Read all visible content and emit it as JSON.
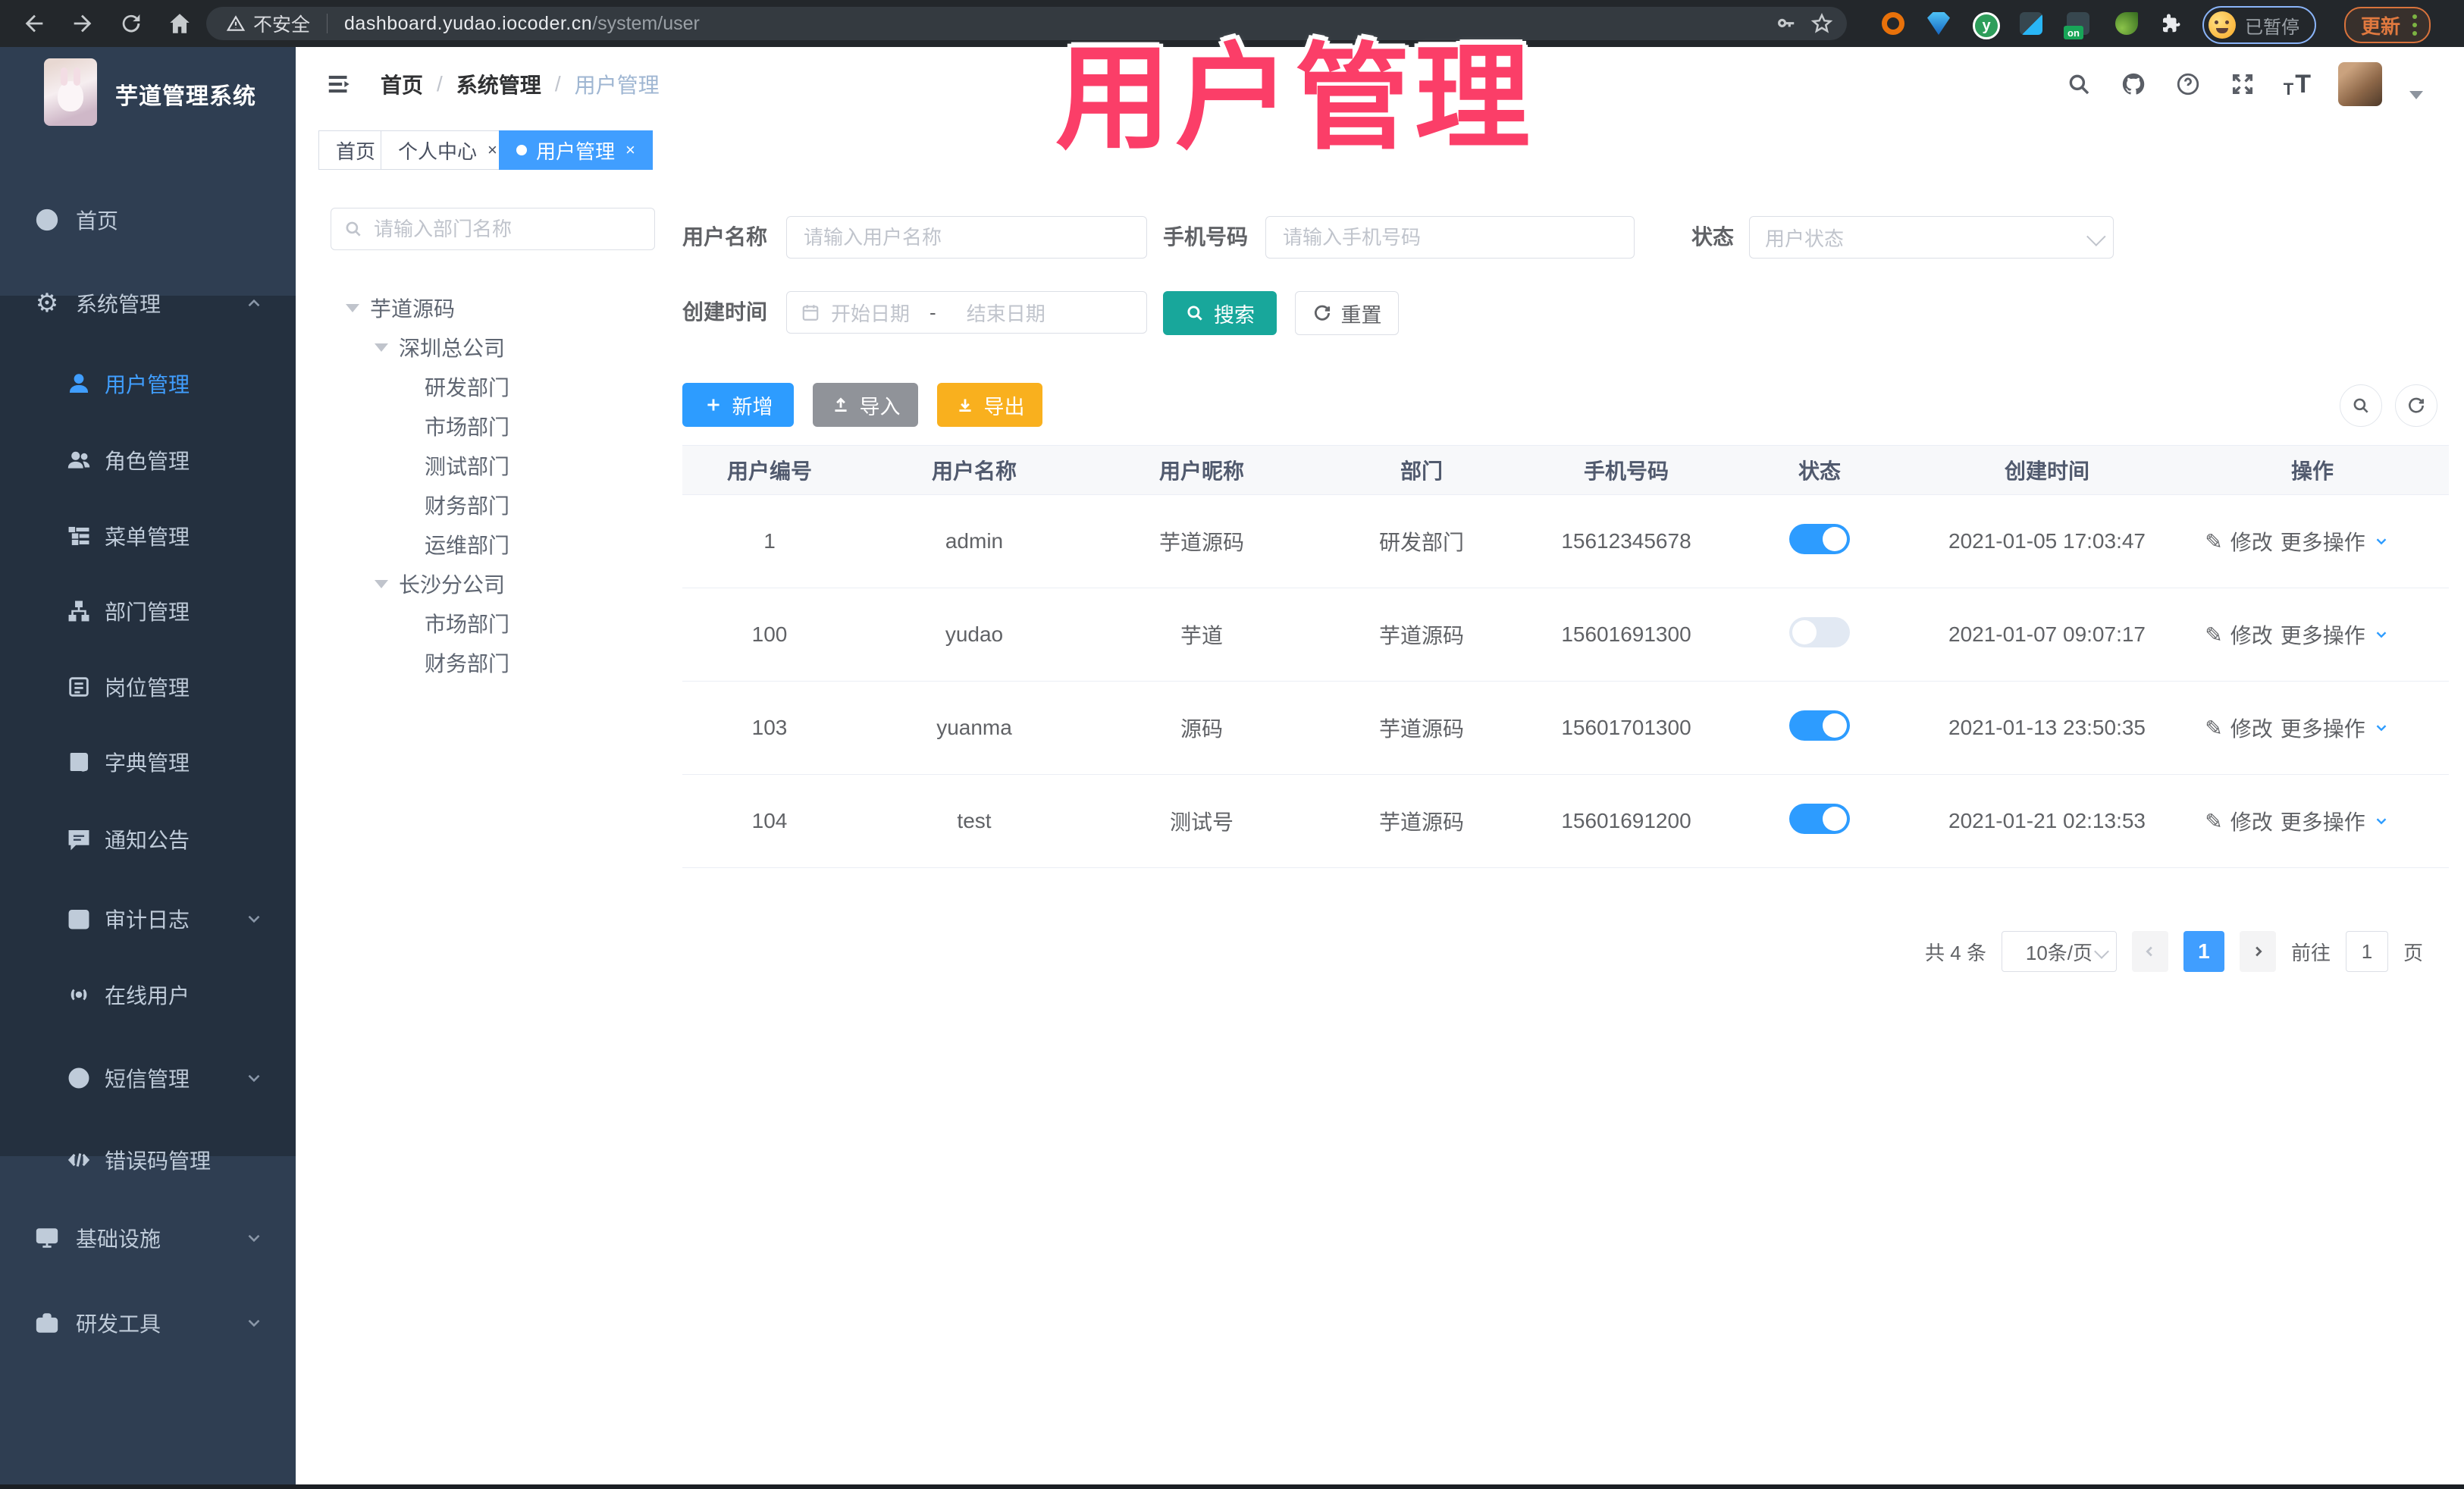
{
  "browser": {
    "security_label": "不安全",
    "url_host": "dashboard.yudao.iocoder.cn",
    "url_path": "/system/user",
    "paused_badge": "已暂停",
    "update_button": "更新"
  },
  "app": {
    "title": "芋道管理系统",
    "breadcrumb": [
      "首页",
      "系统管理",
      "用户管理"
    ],
    "tabs": [
      {
        "label": "首页",
        "closable": false,
        "active": false
      },
      {
        "label": "个人中心",
        "closable": true,
        "active": false
      },
      {
        "label": "用户管理",
        "closable": true,
        "active": true
      }
    ]
  },
  "sidebar": {
    "items": [
      {
        "label": "首页",
        "icon": "dashboard-icon",
        "level": "top"
      },
      {
        "label": "系统管理",
        "icon": "gear-icon",
        "level": "top",
        "chevron": "up"
      },
      {
        "label": "用户管理",
        "icon": "user-icon",
        "level": "sub",
        "active": true
      },
      {
        "label": "角色管理",
        "icon": "peoples-icon",
        "level": "sub"
      },
      {
        "label": "菜单管理",
        "icon": "tree-table-icon",
        "level": "sub"
      },
      {
        "label": "部门管理",
        "icon": "tree-icon",
        "level": "sub"
      },
      {
        "label": "岗位管理",
        "icon": "post-icon",
        "level": "sub"
      },
      {
        "label": "字典管理",
        "icon": "dict-icon",
        "level": "sub"
      },
      {
        "label": "通知公告",
        "icon": "message-icon",
        "level": "sub"
      },
      {
        "label": "审计日志",
        "icon": "log-icon",
        "level": "sub",
        "chevron": "down"
      },
      {
        "label": "在线用户",
        "icon": "online-icon",
        "level": "sub"
      },
      {
        "label": "短信管理",
        "icon": "sms-icon",
        "level": "sub",
        "chevron": "down"
      },
      {
        "label": "错误码管理",
        "icon": "code-icon",
        "level": "sub"
      },
      {
        "label": "基础设施",
        "icon": "monitor-icon",
        "level": "top",
        "chevron": "down"
      },
      {
        "label": "研发工具",
        "icon": "toolbox-icon",
        "level": "top",
        "chevron": "down"
      }
    ]
  },
  "tree": {
    "search_placeholder": "请输入部门名称",
    "nodes": [
      {
        "label": "芋道源码",
        "level": 0,
        "expandable": true
      },
      {
        "label": "深圳总公司",
        "level": 1,
        "expandable": true
      },
      {
        "label": "研发部门",
        "level": 2
      },
      {
        "label": "市场部门",
        "level": 2
      },
      {
        "label": "测试部门",
        "level": 2
      },
      {
        "label": "财务部门",
        "level": 2
      },
      {
        "label": "运维部门",
        "level": 2
      },
      {
        "label": "长沙分公司",
        "level": 1,
        "expandable": true
      },
      {
        "label": "市场部门",
        "level": 2
      },
      {
        "label": "财务部门",
        "level": 2
      }
    ]
  },
  "filters": {
    "username_label": "用户名称",
    "username_placeholder": "请输入用户名称",
    "mobile_label": "手机号码",
    "mobile_placeholder": "请输入手机号码",
    "status_label": "状态",
    "status_placeholder": "用户状态",
    "created_label": "创建时间",
    "date_start_placeholder": "开始日期",
    "date_separator": "-",
    "date_end_placeholder": "结束日期",
    "search_button": "搜索",
    "reset_button": "重置"
  },
  "toolbar": {
    "add": "新增",
    "import": "导入",
    "export": "导出"
  },
  "table": {
    "headers": [
      "用户编号",
      "用户名称",
      "用户昵称",
      "部门",
      "手机号码",
      "状态",
      "创建时间",
      "操作"
    ],
    "edit_label": "修改",
    "more_label": "更多操作",
    "rows": [
      {
        "id": "1",
        "username": "admin",
        "nickname": "芋道源码",
        "dept": "研发部门",
        "mobile": "15612345678",
        "status": "on",
        "created": "2021-01-05 17:03:47"
      },
      {
        "id": "100",
        "username": "yudao",
        "nickname": "芋道",
        "dept": "芋道源码",
        "mobile": "15601691300",
        "status": "off",
        "created": "2021-01-07 09:07:17"
      },
      {
        "id": "103",
        "username": "yuanma",
        "nickname": "源码",
        "dept": "芋道源码",
        "mobile": "15601701300",
        "status": "on",
        "created": "2021-01-13 23:50:35"
      },
      {
        "id": "104",
        "username": "test",
        "nickname": "测试号",
        "dept": "芋道源码",
        "mobile": "15601691200",
        "status": "on",
        "created": "2021-01-21 02:13:53"
      }
    ]
  },
  "pagination": {
    "total_text": "共 4 条",
    "page_size": "10条/页",
    "current_page": "1",
    "goto_label": "前往",
    "goto_value": "1",
    "page_suffix": "页"
  },
  "overlay": {
    "text": "用户管理"
  },
  "colors": {
    "accent_blue": "#409eff",
    "sidebar_bg": "#2f3e52",
    "sidebar_submenu_bg": "#24303f",
    "search_button": "#18a79b",
    "export_button": "#f9b01e",
    "import_button": "#909399",
    "overlay_pink": "#fb3e68",
    "chrome_bg": "#23272b"
  }
}
